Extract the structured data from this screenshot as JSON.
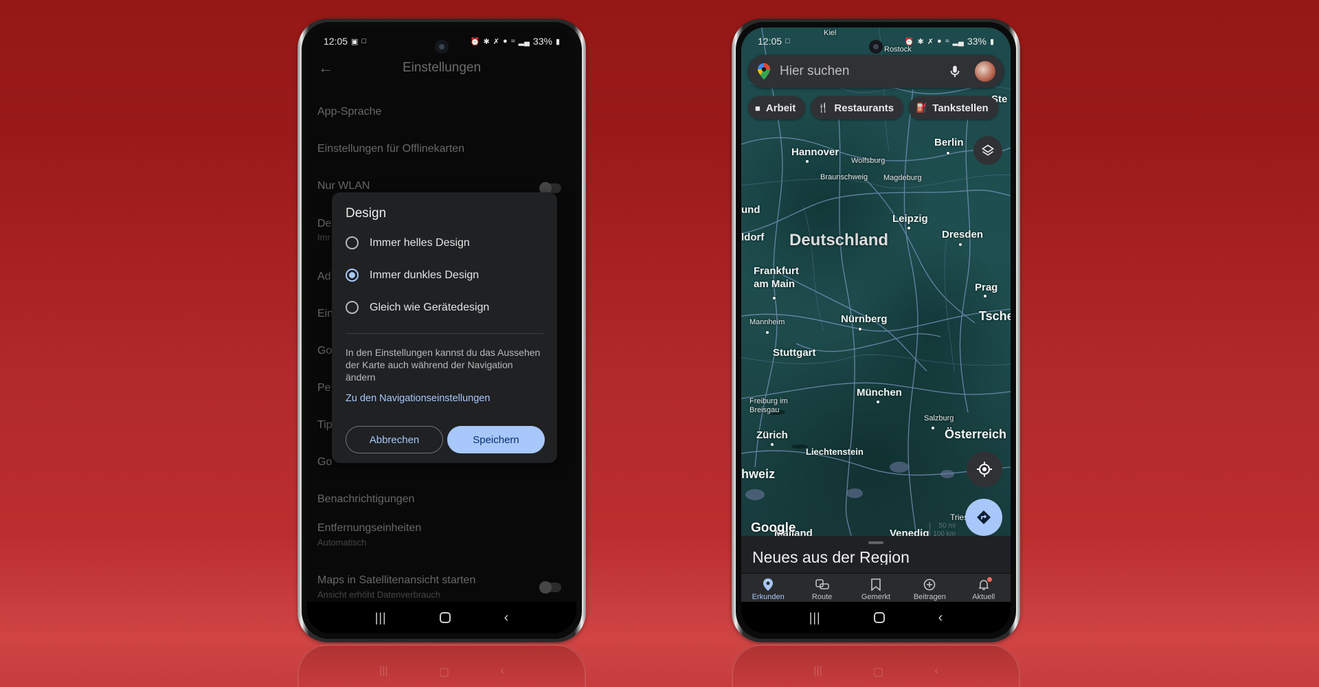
{
  "status_bar": {
    "time": "12:05",
    "battery": "33%",
    "left_icons_settings": [
      "gallery-icon",
      "laptop-icon"
    ],
    "left_icons_maps": [
      "laptop-icon"
    ],
    "right_icons": [
      "alarm-icon",
      "bluetooth-icon",
      "mute-icon",
      "location-icon",
      "wifi-icon",
      "signal-icon",
      "battery-icon"
    ]
  },
  "settings_phone": {
    "title": "Einstellungen",
    "items": [
      {
        "label": "App-Sprache"
      },
      {
        "label": "Einstellungen für Offlinekarten"
      },
      {
        "label": "Nur WLAN",
        "toggle": false
      },
      {
        "label": "De",
        "sub": "Imr"
      },
      {
        "label": "Ad"
      },
      {
        "label": "Ein"
      },
      {
        "label": "Go"
      },
      {
        "label": "Pe"
      },
      {
        "label": "Tip"
      },
      {
        "label": "Go"
      },
      {
        "label": "Benachrichtigungen"
      },
      {
        "label": "Entfernungseinheiten",
        "sub": "Automatisch"
      },
      {
        "label": "Maps in Satellitenansicht starten",
        "sub": "Ansicht erhöht Datenverbrauch",
        "toggle": false
      }
    ],
    "dialog": {
      "title": "Design",
      "options": [
        {
          "label": "Immer helles Design",
          "selected": false
        },
        {
          "label": "Immer dunkles Design",
          "selected": true
        },
        {
          "label": "Gleich wie Gerätedesign",
          "selected": false
        }
      ],
      "info_text": "In den Einstellungen kannst du das Aussehen der Karte auch während der Navigation ändern",
      "link": "Zu den Navigationseinstellungen",
      "cancel_label": "Abbrechen",
      "save_label": "Speichern"
    }
  },
  "maps_phone": {
    "search_placeholder": "Hier suchen",
    "chips": [
      {
        "label": "Arbeit",
        "icon": "briefcase-icon"
      },
      {
        "label": "Restaurants",
        "icon": "restaurant-icon"
      },
      {
        "label": "Tankstellen",
        "icon": "gas-station-icon"
      }
    ],
    "map_labels": {
      "kiel": "Kiel",
      "rostock": "Rostock",
      "stettin": "Ste",
      "hannover": "Hannover",
      "wolfsburg": "Wolfsburg",
      "braunschweig": "Braunschweig",
      "magdeburg": "Magdeburg",
      "berlin": "Berlin",
      "und": "und",
      "dorf": "ldorf",
      "leipzig": "Leipzig",
      "dresden": "Dresden",
      "deutschland": "Deutschland",
      "frankfurt": "Frankfurt\nam Main",
      "prag": "Prag",
      "tsche": "Tsche",
      "mannheim": "Mannheim",
      "nuernberg": "Nürnberg",
      "stuttgart": "Stuttgart",
      "muenchen": "München",
      "freiburg": "Freiburg im\nBreisgau",
      "salzburg": "Salzburg",
      "zuerich": "Zürich",
      "oesterreich": "Österreich",
      "liechtenstein": "Liechtenstein",
      "schweiz": "hweiz",
      "triest": "Triest",
      "mailand": "Mailand",
      "venedig": "Venedig"
    },
    "google_logo": "Google",
    "scale": {
      "top": "50 mi",
      "bottom": "100 km"
    },
    "sheet_title": "Neues aus der Region",
    "bottom_nav": [
      {
        "label": "Erkunden",
        "icon": "explore-pin-icon",
        "active": true
      },
      {
        "label": "Route",
        "icon": "commute-icon",
        "active": false
      },
      {
        "label": "Gemerkt",
        "icon": "bookmark-icon",
        "active": false
      },
      {
        "label": "Beitragen",
        "icon": "add-circle-icon",
        "active": false
      },
      {
        "label": "Aktuell",
        "icon": "bell-icon",
        "active": false,
        "badge": true
      }
    ]
  },
  "system_nav": {
    "recents": "recents",
    "home": "home",
    "back": "back"
  },
  "colors": {
    "accent": "#a8c7fa",
    "map_bg": "#1f4f50",
    "background_red": "#b22a2c",
    "badge": "#ee675c"
  }
}
